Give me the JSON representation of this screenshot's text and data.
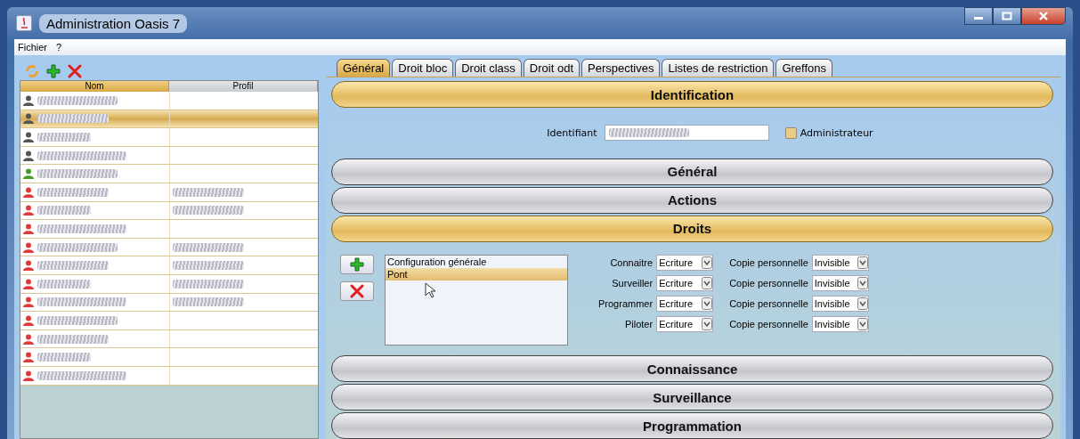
{
  "window": {
    "title": "Administration Oasis 7"
  },
  "menu": [
    "Fichier",
    "?"
  ],
  "users": {
    "columns": [
      "Nom",
      "Profil"
    ],
    "rows": [
      {
        "color": "#555555",
        "selected": false,
        "profile_redacted": false
      },
      {
        "color": "#555555",
        "selected": true,
        "profile_redacted": false
      },
      {
        "color": "#555555",
        "selected": false,
        "profile_redacted": false
      },
      {
        "color": "#555555",
        "selected": false,
        "profile_redacted": false
      },
      {
        "color": "#4a9a2a",
        "selected": false,
        "profile_redacted": false
      },
      {
        "color": "#e03a3a",
        "selected": false,
        "profile_redacted": true
      },
      {
        "color": "#e03a3a",
        "selected": false,
        "profile_redacted": true
      },
      {
        "color": "#e03a3a",
        "selected": false,
        "profile_redacted": false
      },
      {
        "color": "#e03a3a",
        "selected": false,
        "profile_redacted": true
      },
      {
        "color": "#e03a3a",
        "selected": false,
        "profile_redacted": true
      },
      {
        "color": "#e03a3a",
        "selected": false,
        "profile_redacted": true
      },
      {
        "color": "#e03a3a",
        "selected": false,
        "profile_redacted": true
      },
      {
        "color": "#e03a3a",
        "selected": false,
        "profile_redacted": false
      },
      {
        "color": "#e03a3a",
        "selected": false,
        "profile_redacted": false
      },
      {
        "color": "#e03a3a",
        "selected": false,
        "profile_redacted": false
      },
      {
        "color": "#e03a3a",
        "selected": false,
        "profile_redacted": false
      }
    ]
  },
  "tabs": [
    {
      "label": "Général",
      "selected": true
    },
    {
      "label": "Droit bloc",
      "selected": false
    },
    {
      "label": "Droit class",
      "selected": false
    },
    {
      "label": "Droit odt",
      "selected": false
    },
    {
      "label": "Perspectives",
      "selected": false
    },
    {
      "label": "Listes de restriction",
      "selected": false
    },
    {
      "label": "Greffons",
      "selected": false
    }
  ],
  "sections": [
    {
      "title": "Identification",
      "expanded": true,
      "kind": "identification",
      "field_label": "Identifiant",
      "checkbox": {
        "label": "Administrateur",
        "checked": false
      }
    },
    {
      "title": "Général",
      "expanded": false,
      "kind": "plain"
    },
    {
      "title": "Actions",
      "expanded": false,
      "kind": "plain"
    },
    {
      "title": "Droits",
      "expanded": true,
      "kind": "rights",
      "items": [
        {
          "label": "Configuration générale",
          "selected": false
        },
        {
          "label": "Pont",
          "selected": true
        }
      ],
      "rights": [
        {
          "label": "Connaitre",
          "value": "Ecriture",
          "copy_label": "Copie personnelle",
          "copy_value": "Invisible"
        },
        {
          "label": "Surveiller",
          "value": "Ecriture",
          "copy_label": "Copie personnelle",
          "copy_value": "Invisible"
        },
        {
          "label": "Programmer",
          "value": "Ecriture",
          "copy_label": "Copie personnelle",
          "copy_value": "Invisible"
        },
        {
          "label": "Piloter",
          "value": "Ecriture",
          "copy_label": "Copie personnelle",
          "copy_value": "Invisible"
        }
      ]
    },
    {
      "title": "Connaissance",
      "expanded": false,
      "kind": "plain"
    },
    {
      "title": "Surveillance",
      "expanded": false,
      "kind": "plain"
    },
    {
      "title": "Programmation",
      "expanded": false,
      "kind": "plain"
    }
  ]
}
